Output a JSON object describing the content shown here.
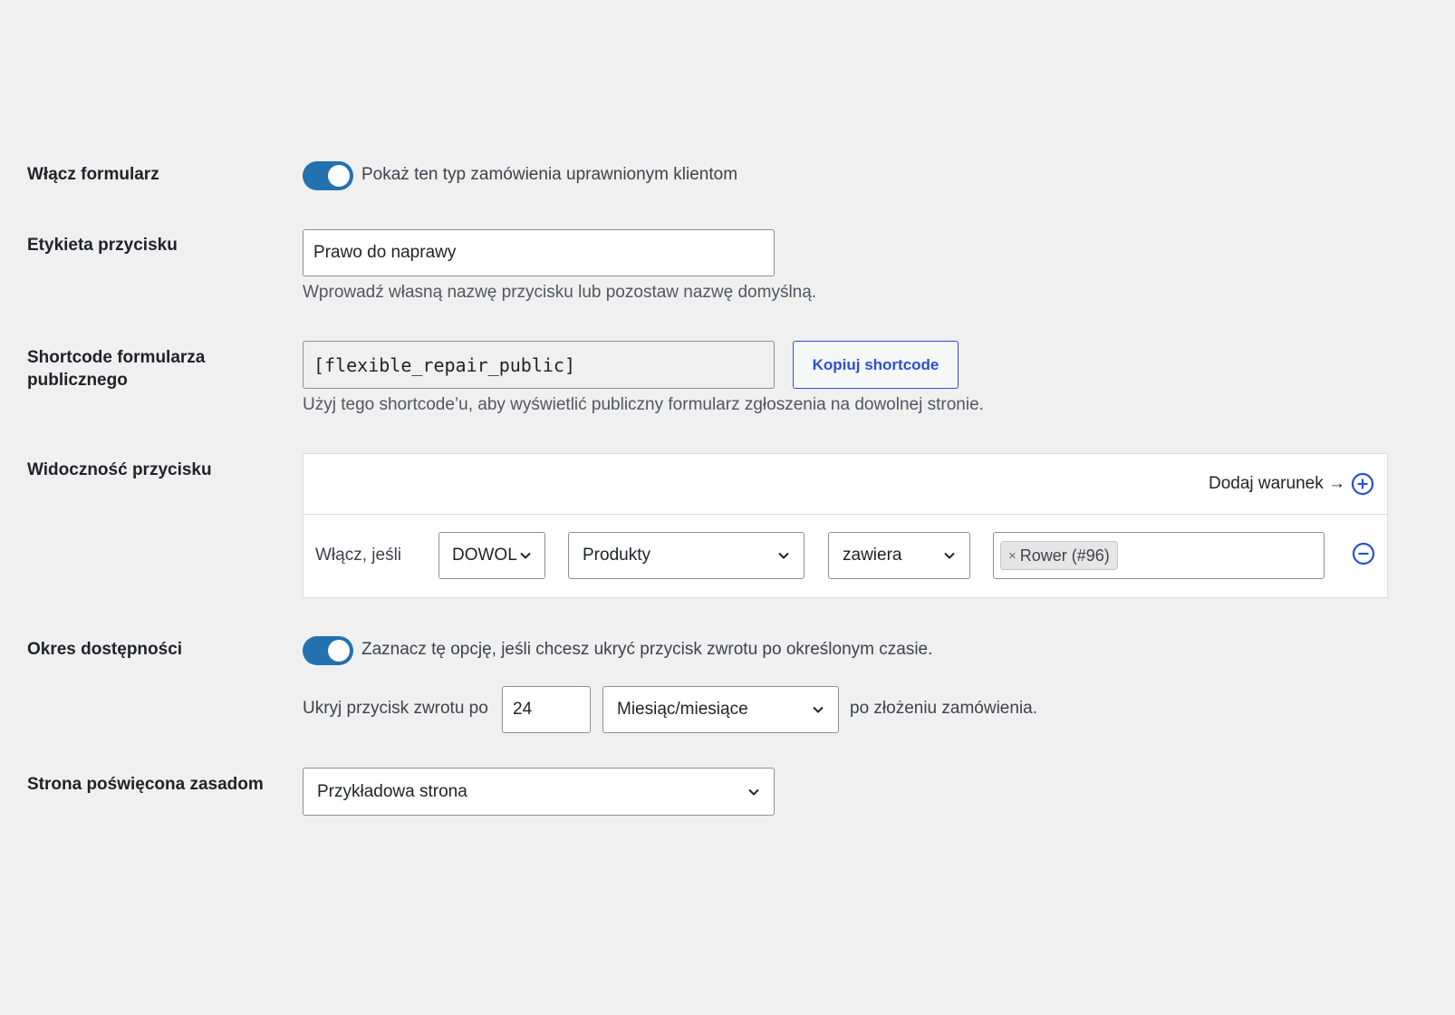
{
  "enable_form": {
    "label": "Włącz formularz",
    "toggle_on": true,
    "toggle_text": "Pokaż ten typ zamówienia uprawnionym klientom"
  },
  "button_label": {
    "label": "Etykieta przycisku",
    "value": "Prawo do naprawy",
    "description": "Wprowadź własną nazwę przycisku lub pozostaw nazwę domyślną."
  },
  "shortcode": {
    "label_line1": "Shortcode formularza",
    "label_line2": "publicznego",
    "value": "[flexible_repair_public]",
    "copy_button": "Kopiuj shortcode",
    "description": "Użyj tego shortcode’u, aby wyświetlić publiczny formularz zgłoszenia na dowolnej stronie."
  },
  "visibility": {
    "label": "Widoczność przycisku",
    "add_condition": "Dodaj warunek →",
    "rule": {
      "prefix": "Włącz, jeśli",
      "mode_select": "DOWOL",
      "field_select": "Produkty",
      "operator_select": "zawiera",
      "values": [
        "Rower (#96)"
      ],
      "chip_remove": "×"
    }
  },
  "availability": {
    "label": "Okres dostępności",
    "toggle_on": true,
    "toggle_text": "Zaznacz tę opcję, jeśli chcesz ukryć przycisk zwrotu po określonym czasie.",
    "hide_prefix": "Ukryj przycisk zwrotu po",
    "amount": "24",
    "unit_select": "Miesiąc/miesiące",
    "hide_suffix": "po złożeniu zamówienia."
  },
  "policy_page": {
    "label": "Strona poświęcona zasadom",
    "select": "Przykładowa strona"
  },
  "colors": {
    "toggle": "#2271b1",
    "link": "#2a4fd8"
  }
}
